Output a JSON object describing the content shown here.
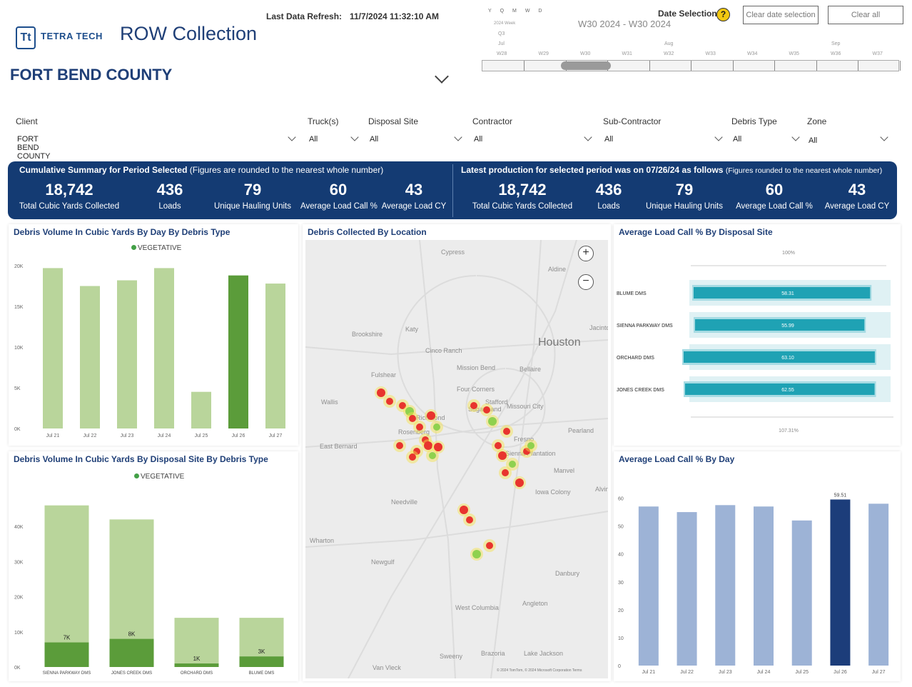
{
  "header": {
    "logo_mark": "Tt",
    "logo_text": "TETRA TECH",
    "report_title": "ROW Collection",
    "county": "FORT BEND COUNTY",
    "last_refresh_label": "Last Data Refresh:",
    "last_refresh_value": "11/7/2024 11:32:10 AM"
  },
  "date_slicer": {
    "label": "Date Selection",
    "help": "?",
    "range": "W30 2024 - W30 2024",
    "clear_date_button": "Clear date selection",
    "clear_all_button": "Clear all",
    "hierarchy": [
      "Y",
      "Q",
      "M",
      "W",
      "D"
    ],
    "upper_labels": [
      "2024 Week",
      "Q3",
      "Jul",
      "Aug",
      "Sep"
    ],
    "weeks": [
      "W28",
      "W29",
      "W30",
      "W31",
      "W32",
      "W33",
      "W34",
      "W35",
      "W36",
      "W37"
    ]
  },
  "filters": [
    {
      "label": "Client",
      "value": "FORT BEND COUNTY"
    },
    {
      "label": "Truck(s)",
      "value": "All"
    },
    {
      "label": "Disposal Site",
      "value": "All"
    },
    {
      "label": "Contractor",
      "value": "All"
    },
    {
      "label": "Sub-Contractor",
      "value": "All"
    },
    {
      "label": "Debris Type",
      "value": "All"
    },
    {
      "label": "Zone",
      "value": "All"
    }
  ],
  "summary": {
    "cumulative_title": "Cumulative Summary for Period Selected",
    "cumulative_note": "(Figures are rounded to the nearest whole number)",
    "latest_title": "Latest production for selected period was on",
    "latest_date": "07/26/24",
    "latest_suffix": "as follows",
    "latest_note": "(Figures rounded to the nearest whole number)",
    "cumulative_kpis": [
      {
        "value": "18,742",
        "label": "Total Cubic Yards Collected"
      },
      {
        "value": "436",
        "label": "Loads"
      },
      {
        "value": "79",
        "label": "Unique Hauling Units"
      },
      {
        "value": "60",
        "label": "Average Load Call %"
      },
      {
        "value": "43",
        "label": "Average Load CY"
      }
    ],
    "latest_kpis": [
      {
        "value": "18,742",
        "label": "Total Cubic Yards Collected"
      },
      {
        "value": "436",
        "label": "Loads"
      },
      {
        "value": "79",
        "label": "Unique Hauling Units"
      },
      {
        "value": "60",
        "label": "Average Load Call %"
      },
      {
        "value": "43",
        "label": "Average Load CY"
      }
    ]
  },
  "panels": {
    "by_day_title": "Debris Volume In Cubic Yards By Day By Debris Type",
    "map_title": "Debris Collected By Location",
    "load_call_site_title": "Average Load Call % By Disposal Site",
    "by_site_title": "Debris Volume In Cubic Yards By Disposal Site By Debris Type",
    "load_call_day_title": "Average Load Call % By Day",
    "legend_label": "VEGETATIVE"
  },
  "chart_data": [
    {
      "id": "by_day",
      "type": "bar",
      "title": "Debris Volume In Cubic Yards By Day By Debris Type",
      "categories": [
        "Jul 21",
        "Jul 22",
        "Jul 23",
        "Jul 24",
        "Jul 25",
        "Jul 26",
        "Jul 27"
      ],
      "series": [
        {
          "name": "VEGETATIVE",
          "values": [
            19700,
            17500,
            18200,
            19700,
            4500,
            18800,
            17800
          ]
        }
      ],
      "highlight_index": 5,
      "yticks": [
        "0K",
        "5K",
        "10K",
        "15K",
        "20K"
      ],
      "ylim": [
        0,
        20000
      ],
      "colors": {
        "bar": "#b9d59b",
        "highlight": "#5b9c3a"
      }
    },
    {
      "id": "load_call_site",
      "type": "bar",
      "orientation": "horizontal",
      "title": "Average Load Call % By Disposal Site",
      "categories": [
        "BLUME DMS",
        "SIENNA PARKWAY DMS",
        "ORCHARD DMS",
        "JONES CREEK DMS"
      ],
      "values": [
        58.31,
        55.99,
        63.1,
        62.55
      ],
      "value_labels": [
        "58.31",
        "55.99",
        "63.10",
        "62.55"
      ],
      "top_label": "100%",
      "bottom_label": "107.31%",
      "colors": {
        "bar": "#1fa2b4",
        "band": "#a6dbe3"
      }
    },
    {
      "id": "by_site",
      "type": "bar",
      "stacked": true,
      "title": "Debris Volume In Cubic Yards By Disposal Site By Debris Type",
      "categories": [
        "SIENNA PARKWAY DMS",
        "JONES CREEK DMS",
        "ORCHARD DMS",
        "BLUME DMS"
      ],
      "series": [
        {
          "name": "VEGETATIVE",
          "values": [
            7000,
            8000,
            1000,
            3000
          ],
          "labels": [
            "7K",
            "8K",
            "1K",
            "3K"
          ]
        }
      ],
      "background_totals": [
        46000,
        42000,
        14000,
        14000
      ],
      "yticks": [
        "0K",
        "10K",
        "20K",
        "30K",
        "40K"
      ],
      "ylim": [
        0,
        50000
      ],
      "colors": {
        "bar": "#5b9c3a",
        "back": "#b9d59b"
      }
    },
    {
      "id": "load_call_day",
      "type": "bar",
      "title": "Average Load Call % By Day",
      "categories": [
        "Jul 21",
        "Jul 22",
        "Jul 23",
        "Jul 24",
        "Jul 25",
        "Jul 26",
        "Jul 27"
      ],
      "values": [
        57,
        55,
        57.5,
        57,
        52,
        59.51,
        58
      ],
      "highlight_index": 5,
      "highlight_label": "59.51",
      "yticks": [
        "0",
        "10",
        "20",
        "30",
        "40",
        "50",
        "60"
      ],
      "ylim": [
        0,
        65
      ],
      "colors": {
        "bar": "#9db3d6",
        "highlight": "#1c3d7a"
      }
    }
  ],
  "map": {
    "labels": [
      {
        "text": "Cypress",
        "size": "s"
      },
      {
        "text": "Aldine",
        "size": "s"
      },
      {
        "text": "Brookshire",
        "size": "s"
      },
      {
        "text": "Katy",
        "size": "s"
      },
      {
        "text": "Cinco Ranch",
        "size": "s"
      },
      {
        "text": "Houston",
        "size": "big"
      },
      {
        "text": "Jacinto City",
        "size": "s"
      },
      {
        "text": "Mission Bend",
        "size": "s"
      },
      {
        "text": "Bellaire",
        "size": "s"
      },
      {
        "text": "Fulshear",
        "size": "s"
      },
      {
        "text": "Four Corners",
        "size": "s"
      },
      {
        "text": "Wallis",
        "size": "s"
      },
      {
        "text": "Sugar Land",
        "size": "s"
      },
      {
        "text": "Stafford",
        "size": "s"
      },
      {
        "text": "Missouri City",
        "size": "s"
      },
      {
        "text": "Richmond",
        "size": "s"
      },
      {
        "text": "Rosenberg",
        "size": "s"
      },
      {
        "text": "Pearland",
        "size": "s"
      },
      {
        "text": "East Bernard",
        "size": "s"
      },
      {
        "text": "Fresno",
        "size": "s"
      },
      {
        "text": "Sienna Plantation",
        "size": "s"
      },
      {
        "text": "Manvel",
        "size": "s"
      },
      {
        "text": "Iowa Colony",
        "size": "s"
      },
      {
        "text": "Alvin",
        "size": "s"
      },
      {
        "text": "Needville",
        "size": "s"
      },
      {
        "text": "Wharton",
        "size": "s"
      },
      {
        "text": "Newgulf",
        "size": "s"
      },
      {
        "text": "Danbury",
        "size": "s"
      },
      {
        "text": "Angleton",
        "size": "s"
      },
      {
        "text": "West Columbia",
        "size": "s"
      },
      {
        "text": "Brazoria",
        "size": "s"
      },
      {
        "text": "Sweeny",
        "size": "s"
      },
      {
        "text": "Lake Jackson",
        "size": "s"
      },
      {
        "text": "Van Vleck",
        "size": "s"
      }
    ],
    "attribution": "© 2024 TomTom, © 2024 Microsoft Corporation Terms"
  }
}
